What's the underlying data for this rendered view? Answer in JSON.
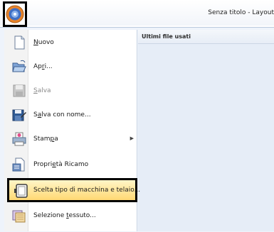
{
  "window": {
    "title": "Senza titolo - Layout"
  },
  "app_button": {
    "icon": "app-logo-icon"
  },
  "menu": {
    "items": [
      {
        "pre": "",
        "key": "N",
        "post": "uovo",
        "icon": "new-document-icon",
        "enabled": true
      },
      {
        "pre": "Ap",
        "key": "r",
        "post": "i...",
        "icon": "open-folder-icon",
        "enabled": true
      },
      {
        "pre": "",
        "key": "S",
        "post": "alva",
        "icon": "save-icon",
        "enabled": false
      },
      {
        "pre": "S",
        "key": "a",
        "post": "lva con nome...",
        "icon": "save-as-icon",
        "enabled": true
      },
      {
        "pre": "Stam",
        "key": "p",
        "post": "a",
        "icon": "print-icon",
        "enabled": true,
        "has_submenu": true
      },
      {
        "pre": "Propri",
        "key": "e",
        "post": "tà Ricamo",
        "icon": "properties-icon",
        "enabled": true
      },
      {
        "pre": "Scelta tipo di macchina e telaio...",
        "key": "",
        "post": "",
        "icon": "hoop-icon",
        "enabled": true
      },
      {
        "pre": "Selezione ",
        "key": "t",
        "post": "essuto...",
        "icon": "fabric-icon",
        "enabled": true
      }
    ]
  },
  "recent": {
    "title": "Ultimi file usati"
  }
}
